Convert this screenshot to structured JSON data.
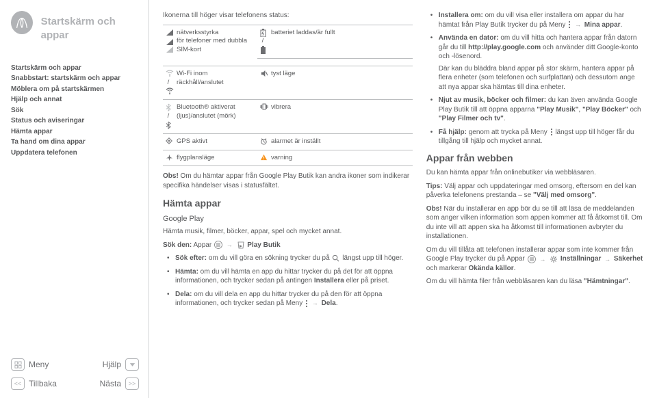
{
  "sidebar": {
    "title": "Startskärm och appar",
    "items": [
      "Startskärm och appar",
      "Snabbstart: startskärm och appar",
      "Möblera om på startskärmen",
      "Hjälp och annat",
      "Sök",
      "Status och aviseringar",
      "Hämta appar",
      "Ta hand om dina appar",
      "Uppdatera telefonen"
    ],
    "menu": "Meny",
    "help": "Hjälp",
    "back": "Tillbaka",
    "next": "Nästa"
  },
  "mid": {
    "intro": "Ikonerna till höger visar telefonens status:",
    "status_rows": [
      {
        "l": "nätverksstyrka",
        "r": "batteriet laddas/är fullt"
      },
      {
        "l": "för telefoner med dubbla SIM-kort",
        "r": ""
      },
      {
        "l": "Wi-Fi inom räckhåll/anslutet",
        "r": "tyst läge"
      },
      {
        "l": "Bluetooth® aktiverat (ljus)/anslutet (mörk)",
        "r": "vibrera"
      },
      {
        "l": "GPS aktivt",
        "r": "alarmet är inställt"
      },
      {
        "l": "flygplansläge",
        "r": "varning"
      }
    ],
    "obs_b": "Obs!",
    "obs_t": " Om du hämtar appar från Google Play Butik kan andra ikoner som indikerar specifika händelser visas i statusfältet.",
    "h2": "Hämta appar",
    "h3": "Google Play",
    "p1": "Hämta musik, filmer, böcker, appar, spel och mycket annat.",
    "sok_b": "Sök den:",
    "sok_t": " Appar",
    "play_butik": "Play Butik",
    "b1_b": "Sök efter:",
    "b1_t": " om du vill göra en sökning trycker du på ",
    "b1_t2": " längst upp till höger.",
    "b2_b": "Hämta:",
    "b2_t": " om du vill hämta en app du hittar trycker du på det för att öppna informationen, och trycker sedan på antingen ",
    "b2_inst": "Installera",
    "b2_t2": " eller på priset.",
    "b3_b": "Dela:",
    "b3_t": " om du vill dela en app du hittar trycker du på den för att öppna informationen, och trycker sedan på Meny",
    "b3_dela": "Dela"
  },
  "right": {
    "b1_b": "Installera om:",
    "b1_t": " om du vill visa eller installera om appar du har hämtat från Play Butik trycker du på Meny",
    "b1_mina": "Mina appar",
    "b2_b": "Använda en dator:",
    "b2_t1": " om du vill hitta och hantera appar från datorn går du till ",
    "b2_url": "http://play.google.com",
    "b2_t2": " och använder ditt Google-konto och -lösenord.",
    "b2_p2": "Där kan du bläddra bland appar på stor skärm, hantera appar på flera enheter (som telefonen och surfplattan) och dessutom ange att nya appar ska hämtas till dina enheter.",
    "b3_b": "Njut av musik, böcker och filmer:",
    "b3_t": " du kan även använda Google Play Butik till att öppna apparna ",
    "b3_q1": "\"Play Musik\"",
    "b3_q2": "\"Play Böcker\"",
    "b3_q3": "\"Play Filmer och tv\"",
    "b3_och1": " och ",
    "b3_och2": " och ",
    "b4_b": "Få hjälp:",
    "b4_t": " genom att trycka på Meny",
    "b4_t2": " längst upp till höger får du tillgång till hjälp och mycket annat.",
    "h2": "Appar från webben",
    "p1": "Du kan hämta appar från onlinebutiker via webbläsaren.",
    "tips_b": "Tips:",
    "tips_t": " Välj appar och uppdateringar med omsorg, eftersom en del kan påverka telefonens prestanda – se ",
    "tips_q": "\"Välj med omsorg\"",
    "obs_b": "Obs!",
    "obs_t": " När du installerar en app bör du se till att läsa de meddelanden som anger vilken information som appen kommer att få åtkomst till. Om du inte vill att appen ska ha åtkomst till informationen avbryter du installationen.",
    "p2a": "Om du vill tillåta att telefonen installerar appar som inte kommer från Google Play trycker du på Appar",
    "p2_in": "Inställningar",
    "p2_sak": "Säkerhet",
    "p2_t": " och markerar ",
    "p2_ok": "Okända källor",
    "p3a": "Om du vill hämta filer från webbläsaren kan du läsa ",
    "p3_q": "\"Hämtningar\""
  }
}
